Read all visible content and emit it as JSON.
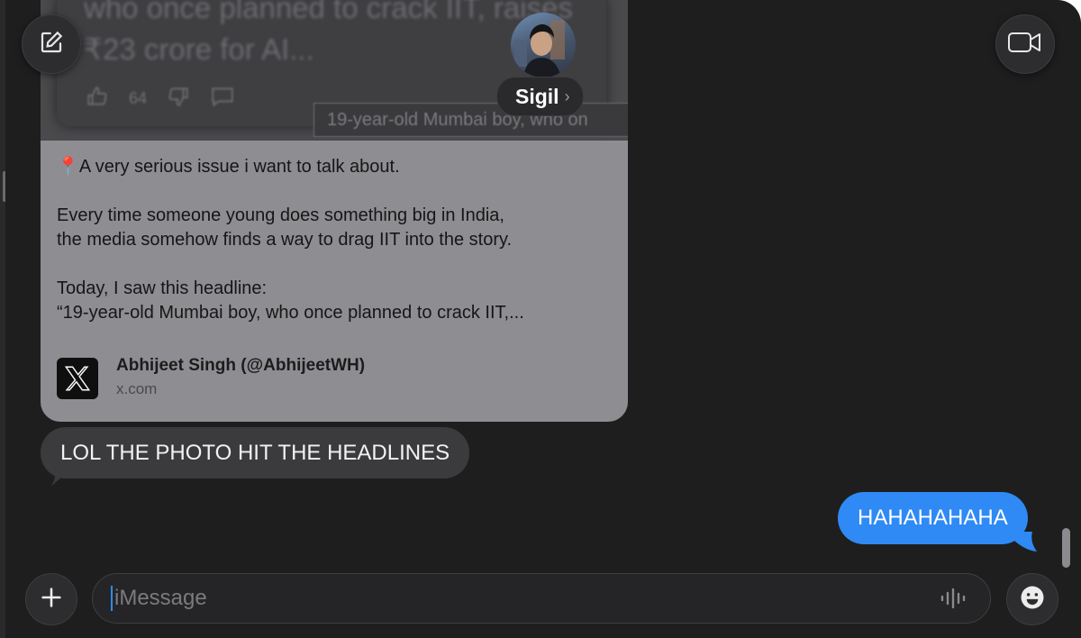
{
  "header": {
    "compose_icon": "compose-icon",
    "video_icon": "video-camera-icon",
    "contact": {
      "name": "Sigil",
      "avatar": "avatar-photo"
    }
  },
  "link_preview": {
    "image_headline": "who once planned to crack IIT, raises ₹23 crore for AI...",
    "image_like_count": "64",
    "image_caption": "19-year-old Mumbai boy, who on",
    "pin_icon": "📍",
    "lines": [
      "A very serious issue i want to talk about.",
      "",
      "Every time someone young does something big in India,",
      "the media somehow finds a way to drag IIT into the story.",
      "",
      "Today, I saw this headline:",
      "“19-year-old Mumbai boy, who once planned to crack IIT,..."
    ],
    "source_name": "Abhijeet Singh (@AbhijeetWH)",
    "source_domain": "x.com",
    "source_icon": "x-logo-icon"
  },
  "messages": {
    "incoming": "LOL THE PHOTO HIT THE HEADLINES",
    "outgoing": "HAHAHAHAHA"
  },
  "composer": {
    "placeholder": "iMessage",
    "value": "",
    "add_icon": "plus-icon",
    "audio_icon": "waveform-icon",
    "emoji_icon": "emoji-icon"
  },
  "colors": {
    "window_bg": "#1e1e1e",
    "outgoing_bubble": "#2f8af5",
    "incoming_bubble": "#3b3b3d",
    "preview_card": "#8e8e92"
  }
}
